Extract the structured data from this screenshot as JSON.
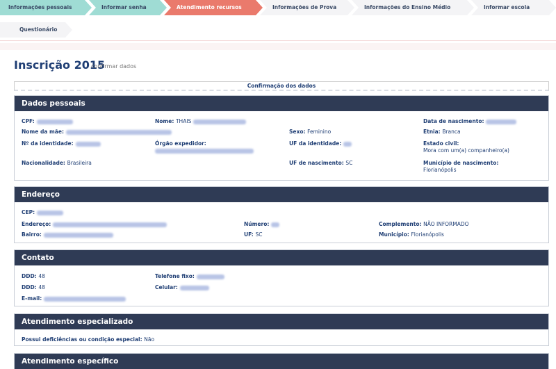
{
  "steps": [
    "Informações pessoais",
    "Informar senha",
    "Atendimento recursos",
    "Informações de Prova",
    "Informações do Ensino Médio",
    "Informar escola",
    "Questionário"
  ],
  "page": {
    "title": "Inscrição 2015",
    "subtitle": "confirmar dados"
  },
  "confirm_bar": "Confirmação dos dados",
  "dados_pessoais": {
    "title": "Dados pessoais",
    "cpf": "CPF:",
    "nome": "Nome:",
    "nome_val": "THAIS",
    "data_nasc": "Data de nascimento:",
    "nome_mae": "Nome da mãe:",
    "sexo": "Sexo:",
    "sexo_val": "Feminino",
    "etnia": "Etnia:",
    "etnia_val": "Branca",
    "identidade": "Nº da identidade:",
    "orgao": "Órgão expedidor:",
    "uf_identidade": "UF da identidade:",
    "estado_civil": "Estado civil:",
    "estado_civil_val": "Mora com um(a) companheiro(a)",
    "nacionalidade": "Nacionalidade:",
    "nacionalidade_val": "Brasileira",
    "uf_nasc": "UF de nascimento:",
    "uf_nasc_val": "SC",
    "municipio_nasc": "Município de nascimento:",
    "municipio_nasc_val": "Florianópolis"
  },
  "endereco": {
    "title": "Endereço",
    "cep": "CEP:",
    "endereco": "Endereço:",
    "numero": "Número:",
    "complemento": "Complemento:",
    "complemento_val": "NÃO INFORMADO",
    "bairro": "Bairro:",
    "uf": "UF:",
    "uf_val": "SC",
    "municipio": "Município:",
    "municipio_val": "Florianópolis"
  },
  "contato": {
    "title": "Contato",
    "ddd1": "DDD:",
    "ddd1_val": "48",
    "telefone": "Telefone fixo:",
    "ddd2": "DDD:",
    "ddd2_val": "48",
    "celular": "Celular:",
    "email": "E-mail:"
  },
  "atendimento_especializado": {
    "title": "Atendimento especializado",
    "deficiencia": "Possui deficiências ou condição especial:",
    "deficiencia_val": "Não"
  },
  "atendimento_especifico": {
    "title": "Atendimento específico"
  }
}
